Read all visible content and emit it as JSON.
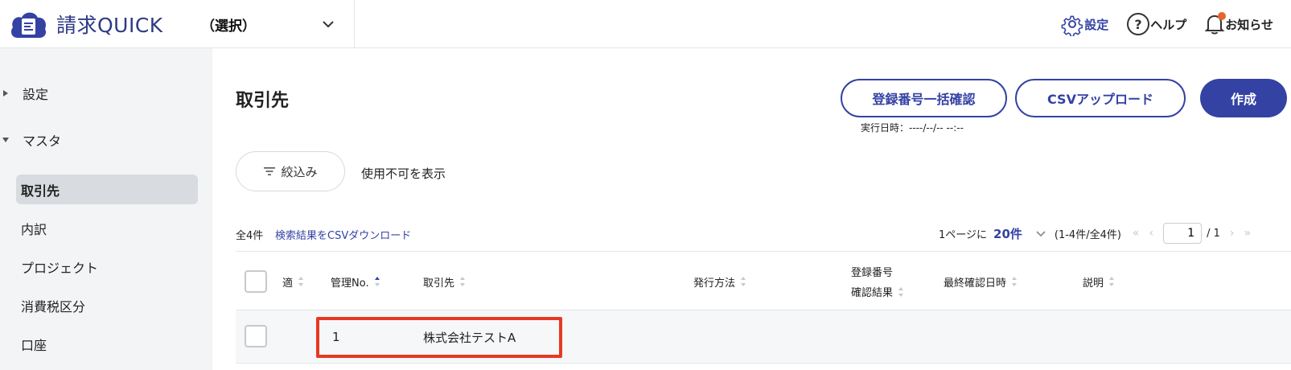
{
  "header": {
    "app_name": "請求QUICK",
    "selector_label": "（選択）",
    "settings_label": "設定",
    "help_label": "ヘルプ",
    "notice_label": "お知らせ"
  },
  "sidebar": {
    "groups": [
      {
        "label": "設定",
        "expanded": false
      },
      {
        "label": "マスタ",
        "expanded": true
      }
    ],
    "items": [
      {
        "label": "取引先",
        "active": true
      },
      {
        "label": "内訳"
      },
      {
        "label": "プロジェクト"
      },
      {
        "label": "消費税区分"
      },
      {
        "label": "口座"
      }
    ]
  },
  "main": {
    "title": "取引先",
    "buttons": {
      "bulk_check": "登録番号一括確認",
      "csv_upload": "CSVアップロード",
      "create": "作成"
    },
    "exec_date": "実行日時：----/--/-- --:--",
    "filter_label": "絞込み",
    "show_disabled": "使用不可を表示",
    "total": "全4件",
    "csv_download": "検索結果をCSVダウンロード",
    "pager": {
      "per_page_prefix": "1ページに",
      "per_page_value": "20件",
      "range": "(1-4件/全4件)",
      "current_page": "1",
      "total_pages": "/ 1"
    }
  },
  "table": {
    "columns": {
      "tekikaku": "適",
      "mgmt_no": "管理No.",
      "partner": "取引先",
      "method": "発行方法",
      "reg_line1": "登録番号",
      "reg_line2": "確認結果",
      "last_check": "最終確認日時",
      "description": "説明"
    },
    "rows": [
      {
        "mgmt_no": "1",
        "partner": "株式会社テストA",
        "method": "",
        "reg_result": "",
        "last_check": "",
        "description": ""
      }
    ]
  },
  "colors": {
    "brand": "#3442a4",
    "highlight": "#e53a22",
    "notice_dot": "#e8642a"
  },
  "icons": [
    "logo-cloud-icon",
    "chevron-down-icon",
    "gear-icon",
    "help-circle-icon",
    "bell-icon",
    "caret-right-icon",
    "caret-down-icon",
    "filter-icon",
    "sort-icon"
  ]
}
